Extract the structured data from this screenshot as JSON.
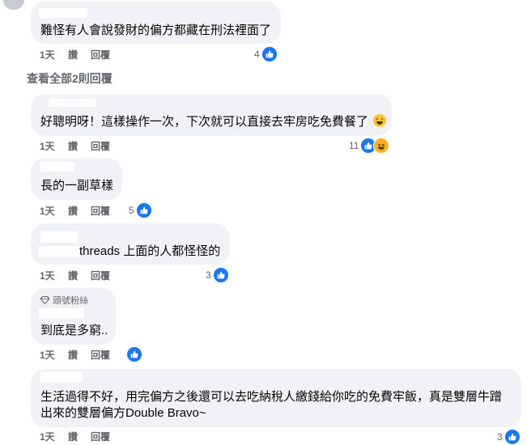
{
  "comments": [
    {
      "id": "c1",
      "text": "難怪有人會說發財的偏方都藏在刑法裡面了",
      "time": "1天",
      "like": "讚",
      "reply": "回覆",
      "reactions": "4"
    },
    {
      "id": "c2",
      "text": "好聰明呀！這樣操作一次，下次就可以直接去牢房吃免費餐了",
      "time": "1天",
      "like": "讚",
      "reply": "回覆",
      "reactions": "11"
    },
    {
      "id": "c3",
      "text": "長的一副草樣",
      "time": "1天",
      "like": "讚",
      "reply": "回覆",
      "reactions": "5"
    },
    {
      "id": "c4",
      "text": "threads 上面的人都怪怪的",
      "time": "1天",
      "like": "讚",
      "reply": "回覆",
      "reactions": "3"
    },
    {
      "id": "c5",
      "badge": "頭號粉絲",
      "text": "到底是多窮..",
      "time": "1天",
      "like": "讚",
      "reply": "回覆",
      "reactions": ""
    },
    {
      "id": "c6",
      "text_line1": "生活過得不好，用完偏方之後還可以去吃納稅人繳錢給你吃的免費牢飯，真是雙層牛蹭",
      "text_line2": "出來的雙層偏方Double Bravo~",
      "time": "1天",
      "like": "讚",
      "reply": "回覆",
      "reactions": "3"
    }
  ],
  "view_all_replies": "查看全部2則回覆",
  "colors": {
    "bubble": "#f0f2f5",
    "meta": "#65676b",
    "like": "#1877f2",
    "haha": "#f7b125"
  },
  "icons": {
    "like": "like-icon",
    "haha": "haha-icon",
    "badge": "diamond-icon"
  }
}
